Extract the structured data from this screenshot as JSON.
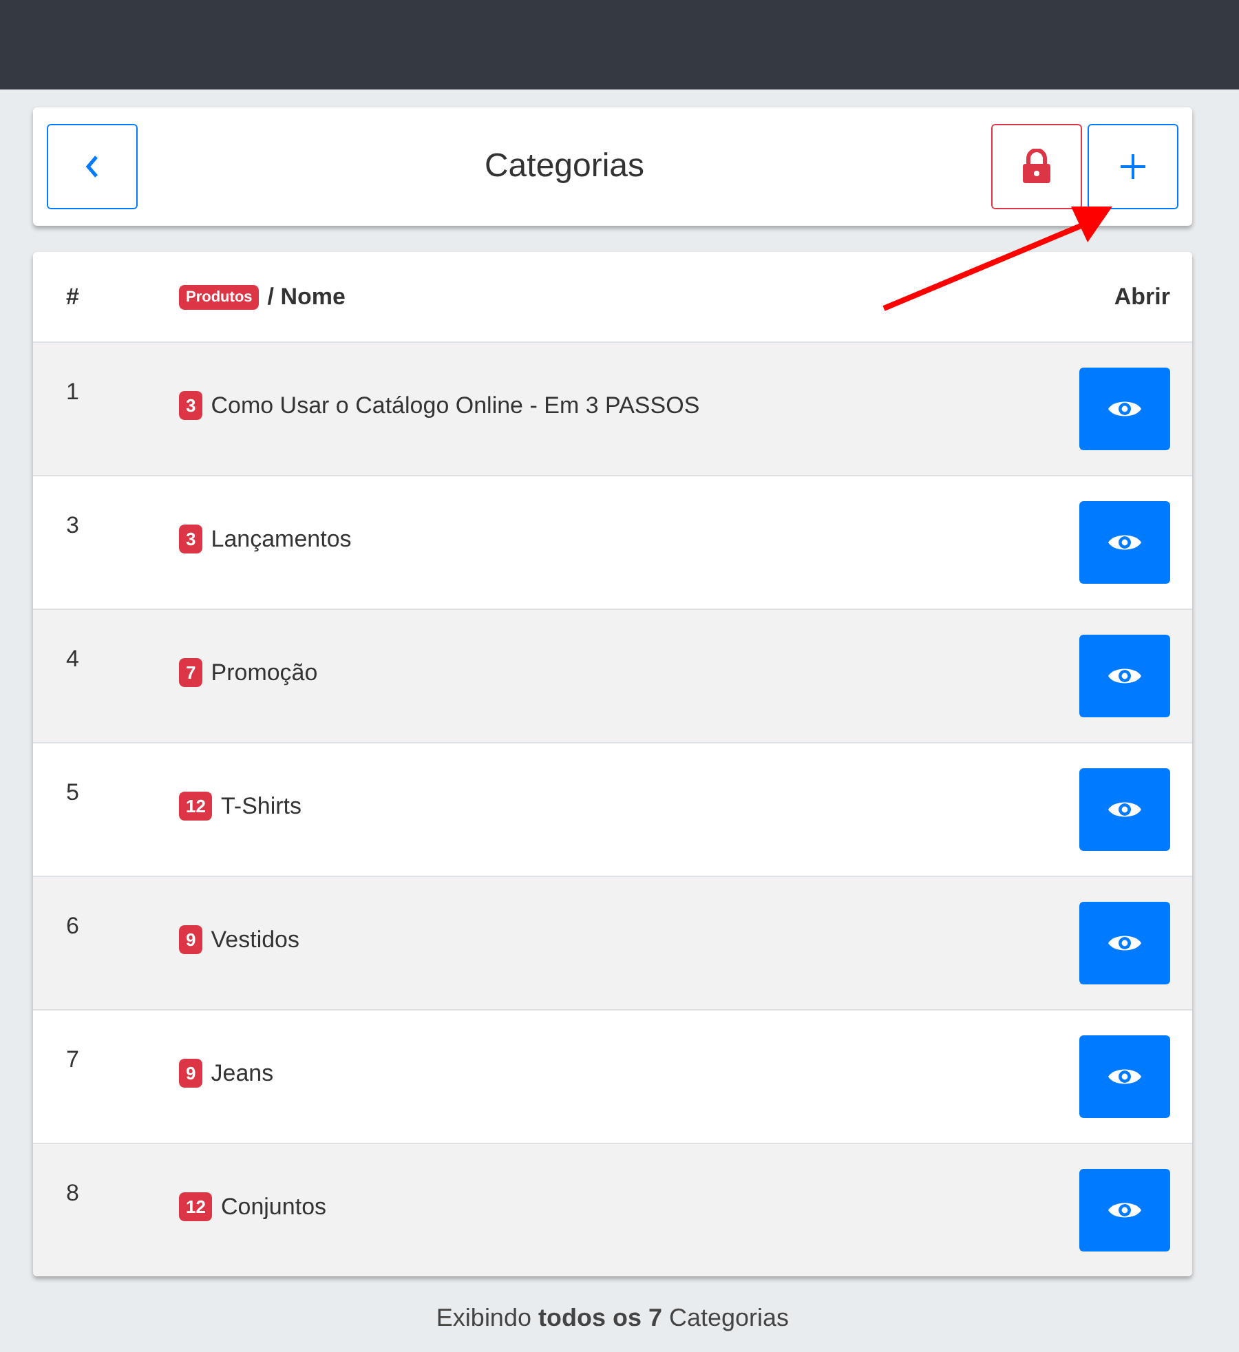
{
  "header": {
    "title": "Categorias"
  },
  "table": {
    "columns": [
      {
        "label": "#"
      },
      {
        "badge": "Produtos",
        "label": "/ Nome"
      },
      {
        "label": "Abrir"
      }
    ],
    "rows": [
      {
        "id": "1",
        "count": "3",
        "name": "Como Usar o Catálogo Online - Em 3 PASSOS"
      },
      {
        "id": "3",
        "count": "3",
        "name": "Lançamentos"
      },
      {
        "id": "4",
        "count": "7",
        "name": "Promoção"
      },
      {
        "id": "5",
        "count": "12",
        "name": "T-Shirts"
      },
      {
        "id": "6",
        "count": "9",
        "name": "Vestidos"
      },
      {
        "id": "7",
        "count": "9",
        "name": "Jeans"
      },
      {
        "id": "8",
        "count": "12",
        "name": "Conjuntos"
      }
    ]
  },
  "footer": "Exibindo **todos os 7** Categorias"
}
